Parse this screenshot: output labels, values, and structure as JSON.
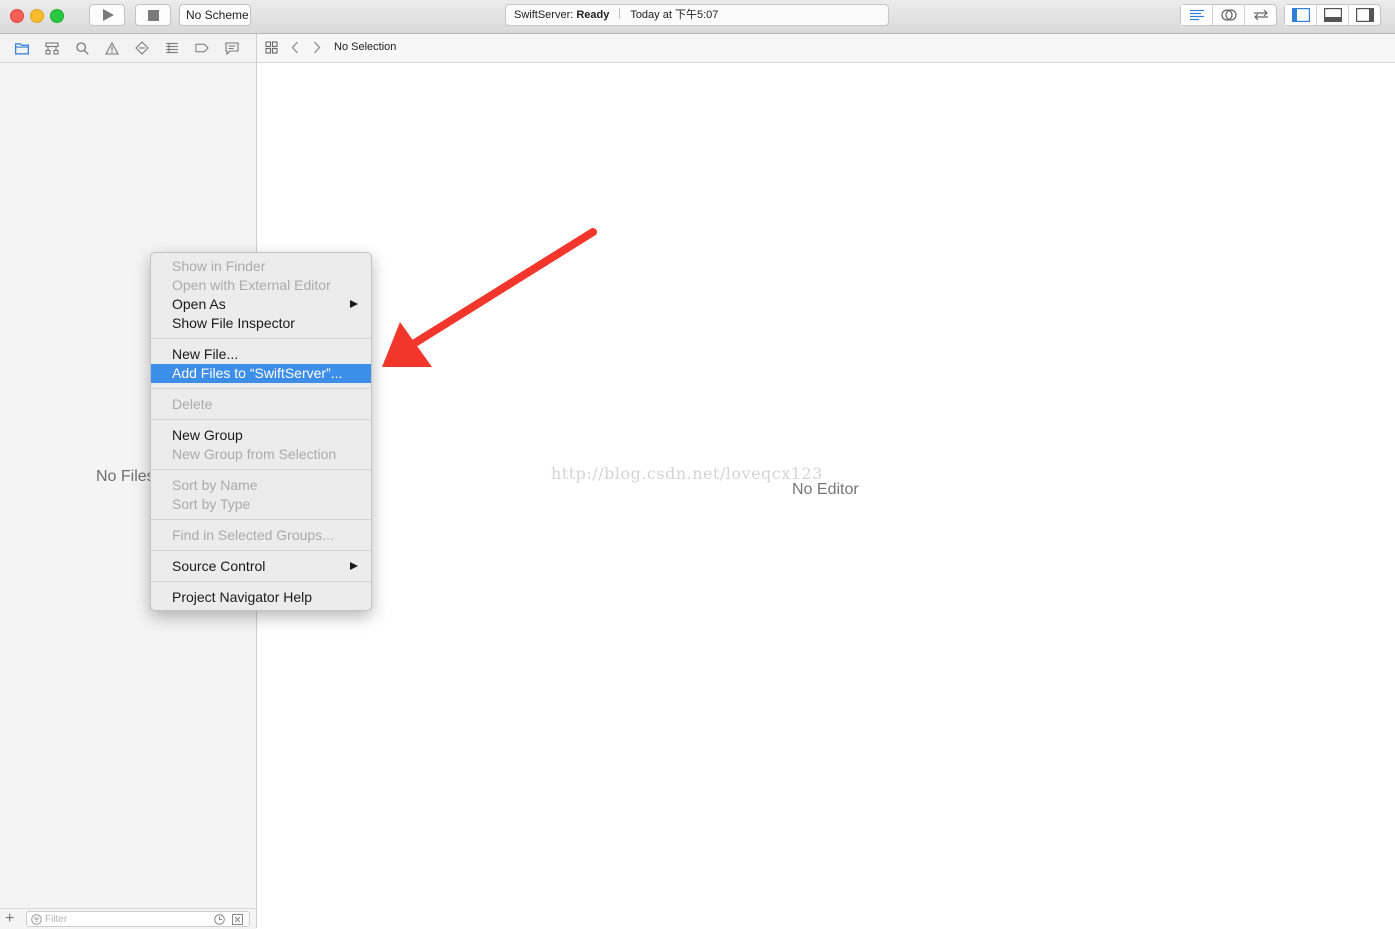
{
  "toolbar": {
    "scheme": "No Scheme",
    "activity_project": "SwiftServer:",
    "activity_status": "Ready",
    "activity_time": "Today at 下午5:07"
  },
  "navigator": {
    "empty_label": "No Files",
    "filter_placeholder": "Filter",
    "tabs": [
      "project-navigator",
      "symbol-navigator",
      "find-navigator",
      "issue-navigator",
      "test-navigator",
      "debug-navigator",
      "breakpoint-navigator",
      "report-navigator"
    ]
  },
  "jumpbar": {
    "breadcrumb": "No Selection"
  },
  "editor": {
    "empty_label": "No Editor",
    "watermark": "http://blog.csdn.net/loveqcx123"
  },
  "context_menu": {
    "show_in_finder": "Show in Finder",
    "open_external": "Open with External Editor",
    "open_as": "Open As",
    "show_file_inspector": "Show File Inspector",
    "new_file": "New File...",
    "add_files": "Add Files to “SwiftServer”...",
    "delete": "Delete",
    "new_group": "New Group",
    "new_group_from_selection": "New Group from Selection",
    "sort_by_name": "Sort by Name",
    "sort_by_type": "Sort by Type",
    "find_in_groups": "Find in Selected Groups...",
    "source_control": "Source Control",
    "navigator_help": "Project Navigator Help"
  },
  "colors": {
    "highlight": "#3d8ee8",
    "annotation_arrow": "#f2362b",
    "accent_icon": "#2f7ed8"
  }
}
